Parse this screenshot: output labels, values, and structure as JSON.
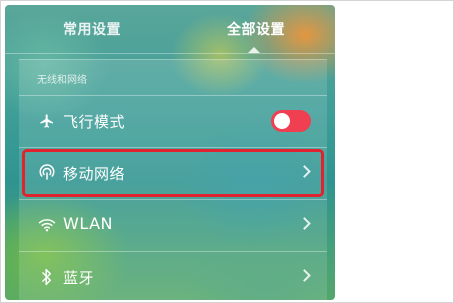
{
  "tabs": {
    "common_label": "常用设置",
    "all_label": "全部设置",
    "active": "全部设置"
  },
  "section": {
    "header": "无线和网络"
  },
  "rows": [
    {
      "label": "飞行模式",
      "icon": "airplane-icon",
      "control": "toggle",
      "toggle_color": "#ef3f50"
    },
    {
      "label": "移动网络",
      "icon": "mobile-network-icon",
      "control": "chevron",
      "highlighted": true
    },
    {
      "label": "WLAN",
      "icon": "wifi-icon",
      "control": "chevron"
    },
    {
      "label": "蓝牙",
      "icon": "bluetooth-icon",
      "control": "chevron"
    }
  ],
  "highlight_color": "#e0232f"
}
